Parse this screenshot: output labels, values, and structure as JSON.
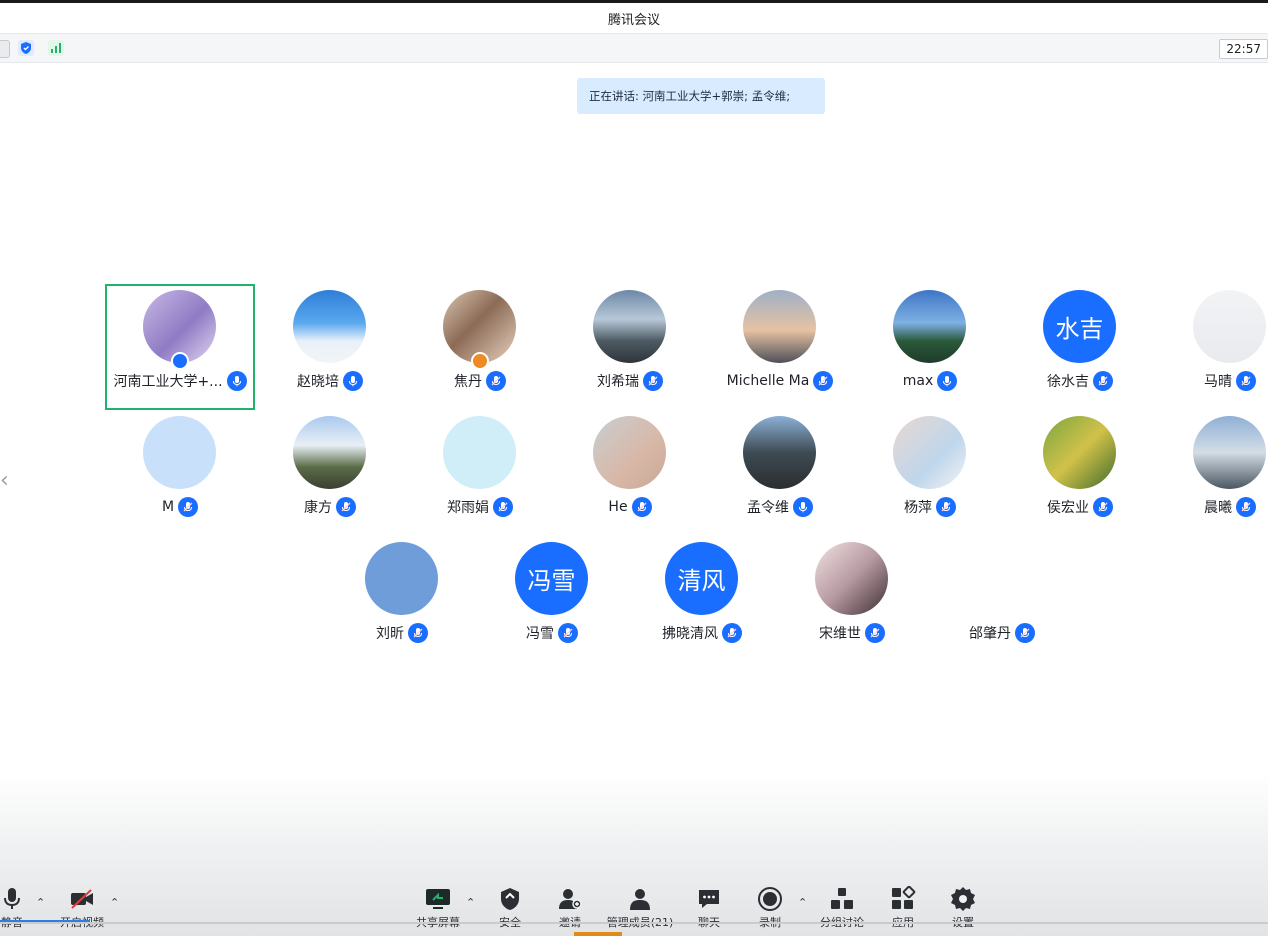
{
  "window": {
    "title": "腾讯会议"
  },
  "statusbar": {
    "icons": [
      "info-icon",
      "security-shield-icon",
      "signal-strength-icon"
    ],
    "clock": "22:57"
  },
  "speaking": {
    "text": "正在讲话: 河南工业大学+郭崇; 孟令维;"
  },
  "participants": [
    {
      "name": "河南工业大学+...",
      "avatar_text": "",
      "mic": "active",
      "badge": "host"
    },
    {
      "name": "赵晓培",
      "avatar_text": "",
      "mic": "active"
    },
    {
      "name": "焦丹",
      "avatar_text": "",
      "mic": "muted",
      "badge": "cohost"
    },
    {
      "name": "刘希瑞",
      "avatar_text": "",
      "mic": "muted"
    },
    {
      "name": "Michelle Ma",
      "avatar_text": "",
      "mic": "muted"
    },
    {
      "name": "max",
      "avatar_text": "",
      "mic": "active"
    },
    {
      "name": "徐水吉",
      "avatar_text": "水吉",
      "mic": "muted"
    },
    {
      "name": "马晴",
      "avatar_text": "",
      "mic": "muted"
    },
    {
      "name": "M",
      "avatar_text": "",
      "mic": "muted"
    },
    {
      "name": "康方",
      "avatar_text": "",
      "mic": "muted"
    },
    {
      "name": "郑雨娟",
      "avatar_text": "",
      "mic": "muted"
    },
    {
      "name": "He",
      "avatar_text": "",
      "mic": "muted"
    },
    {
      "name": "孟令维",
      "avatar_text": "",
      "mic": "active"
    },
    {
      "name": "杨萍",
      "avatar_text": "",
      "mic": "muted"
    },
    {
      "name": "侯宏业",
      "avatar_text": "",
      "mic": "muted"
    },
    {
      "name": "晨曦",
      "avatar_text": "",
      "mic": "muted"
    },
    {
      "name": "刘昕",
      "avatar_text": "",
      "mic": "muted"
    },
    {
      "name": "冯雪",
      "avatar_text": "冯雪",
      "mic": "muted"
    },
    {
      "name": "拂晓清风",
      "avatar_text": "清风",
      "mic": "muted"
    },
    {
      "name": "宋维世",
      "avatar_text": "",
      "mic": "muted"
    },
    {
      "name": "邰肇丹",
      "avatar_text": "",
      "mic": "muted"
    }
  ],
  "toolbar": {
    "mute_label": "静音",
    "video_label": "开启视频",
    "share_label": "共享屏幕",
    "security_label": "安全",
    "invite_label": "邀请",
    "members_label": "管理成员(21)",
    "chat_label": "聊天",
    "record_label": "录制",
    "breakout_label": "分组讨论",
    "apps_label": "应用",
    "settings_label": "设置"
  },
  "colors": {
    "accent": "#1a6eff",
    "active_border": "#1fb36b",
    "speaking_bg": "#d9ecff",
    "host_badge": "#1a6eff",
    "cohost_badge": "#f08a24"
  }
}
